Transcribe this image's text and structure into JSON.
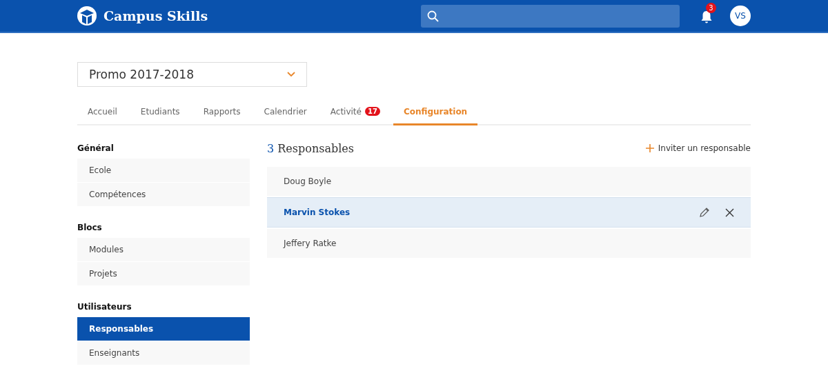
{
  "header": {
    "brand": "Campus Skills",
    "notifications": "3",
    "avatar": "VS"
  },
  "promo_select": {
    "value": "Promo 2017-2018"
  },
  "tabs": [
    {
      "label": "Accueil",
      "selected": false
    },
    {
      "label": "Etudiants",
      "selected": false
    },
    {
      "label": "Rapports",
      "selected": false
    },
    {
      "label": "Calendrier",
      "selected": false
    },
    {
      "label": "Activité",
      "badge": "17",
      "selected": false
    },
    {
      "label": "Configuration",
      "selected": true
    }
  ],
  "sidebar": [
    {
      "heading": "Général",
      "items": [
        {
          "label": "Ecole",
          "selected": false
        },
        {
          "label": "Compétences",
          "selected": false
        }
      ]
    },
    {
      "heading": "Blocs",
      "items": [
        {
          "label": "Modules",
          "selected": false
        },
        {
          "label": "Projets",
          "selected": false
        }
      ]
    },
    {
      "heading": "Utilisateurs",
      "items": [
        {
          "label": "Responsables",
          "selected": true
        },
        {
          "label": "Enseignants",
          "selected": false
        }
      ]
    }
  ],
  "main": {
    "count": "3",
    "title": "Responsables",
    "invite": "Inviter un responsable",
    "rows": [
      {
        "name": "Doug Boyle",
        "selected": false
      },
      {
        "name": "Marvin Stokes",
        "selected": true
      },
      {
        "name": "Jeffery Ratke",
        "selected": false
      }
    ]
  }
}
